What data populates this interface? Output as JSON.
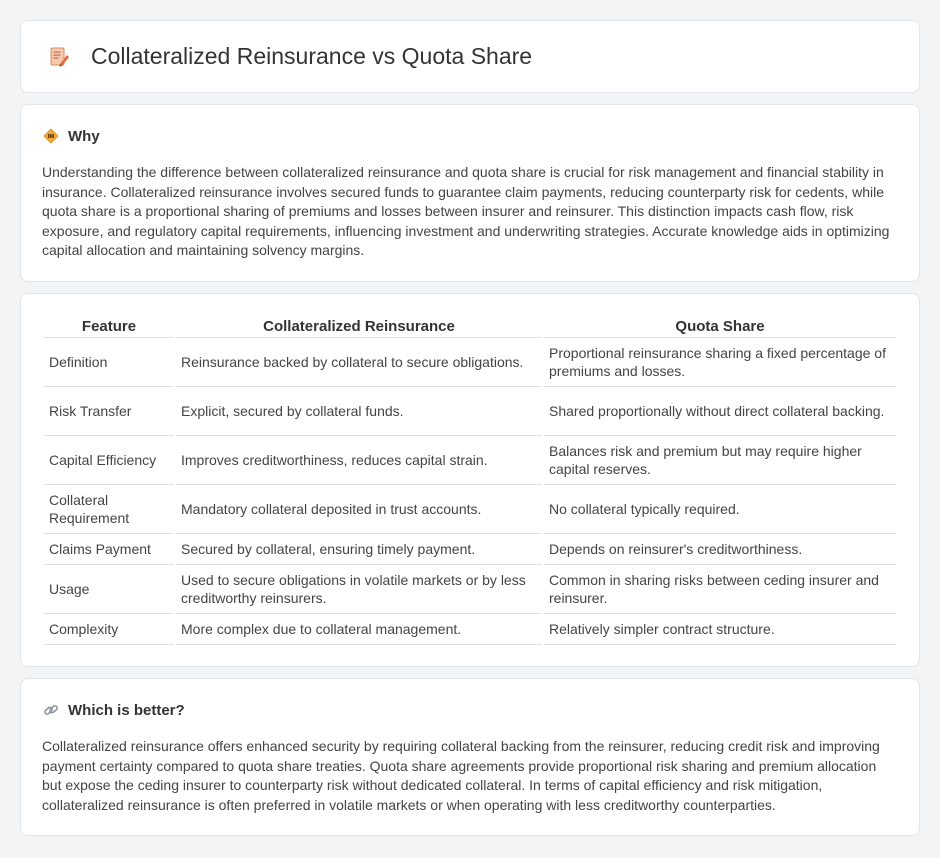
{
  "header": {
    "title": "Collateralized Reinsurance vs Quota Share",
    "icon": "document-pencil-icon"
  },
  "why": {
    "title": "Why",
    "icon": "diamond-sign-icon",
    "text": "Understanding the difference between collateralized reinsurance and quota share is crucial for risk management and financial stability in insurance. Collateralized reinsurance involves secured funds to guarantee claim payments, reducing counterparty risk for cedents, while quota share is a proportional sharing of premiums and losses between insurer and reinsurer. This distinction impacts cash flow, risk exposure, and regulatory capital requirements, influencing investment and underwriting strategies. Accurate knowledge aids in optimizing capital allocation and maintaining solvency margins."
  },
  "table": {
    "headers": [
      "Feature",
      "Collateralized Reinsurance",
      "Quota Share"
    ],
    "rows": [
      [
        "Definition",
        "Reinsurance backed by collateral to secure obligations.",
        "Proportional reinsurance sharing a fixed percentage of premiums and losses."
      ],
      [
        "Risk Transfer",
        "Explicit, secured by collateral funds.",
        "Shared proportionally without direct collateral backing."
      ],
      [
        "Capital Efficiency",
        "Improves creditworthiness, reduces capital strain.",
        "Balances risk and premium but may require higher capital reserves."
      ],
      [
        "Collateral Requirement",
        "Mandatory collateral deposited in trust accounts.",
        "No collateral typically required."
      ],
      [
        "Claims Payment",
        "Secured by collateral, ensuring timely payment.",
        "Depends on reinsurer's creditworthiness."
      ],
      [
        "Usage",
        "Used to secure obligations in volatile markets or by less creditworthy reinsurers.",
        "Common in sharing risks between ceding insurer and reinsurer."
      ],
      [
        "Complexity",
        "More complex due to collateral management.",
        "Relatively simpler contract structure."
      ]
    ]
  },
  "better": {
    "title": "Which is better?",
    "icon": "link-icon",
    "text": "Collateralized reinsurance offers enhanced security by requiring collateral backing from the reinsurer, reducing credit risk and improving payment certainty compared to quota share treaties. Quota share agreements provide proportional risk sharing and premium allocation but expose the ceding insurer to counterparty risk without dedicated collateral. In terms of capital efficiency and risk mitigation, collateralized reinsurance is often preferred in volatile markets or when operating with less creditworthy counterparties."
  }
}
